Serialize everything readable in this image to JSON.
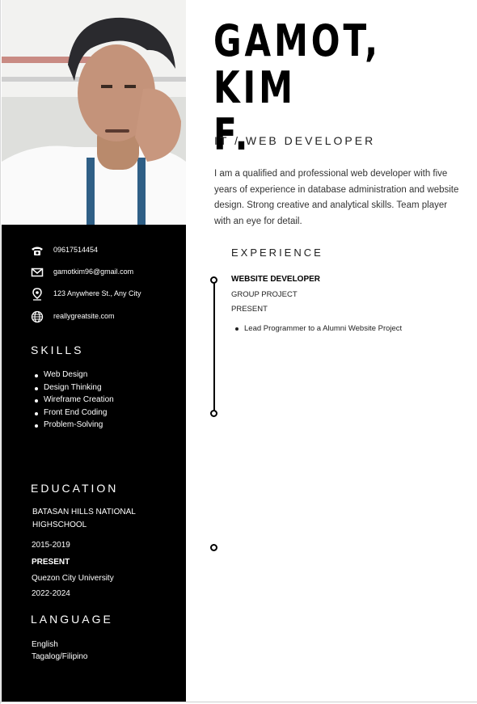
{
  "photo": {
    "description_icon": "profile-photo"
  },
  "contact": {
    "phone": "09617514454",
    "email": "gamotkim96@gmail.com",
    "address": "123 Anywhere St., Any City",
    "website": "reallygreatsite.com"
  },
  "skills": {
    "title": "SKILLS",
    "items": [
      "Web Design",
      "Design Thinking",
      "Wireframe Creation",
      "Front End Coding",
      "Problem-Solving"
    ]
  },
  "education": {
    "title": "EDUCATION",
    "school1_line1": "BATASAN HILLS NATIONAL",
    "school1_line2": "HIGHSCHOOL",
    "school1_years": "2015-2019",
    "present_label": "PRESENT",
    "school2": "Quezon City University",
    "school2_years": "2022-2024"
  },
  "language": {
    "title": "LANGUAGE",
    "items": [
      "English",
      "Tagalog/Filipino"
    ]
  },
  "header": {
    "name_line1": "GAMOT, KIM",
    "name_line2": "F.",
    "role": "IT / WEB DEVELOPER"
  },
  "summary": "I am a qualified and professional web developer with five years of experience in database administration and website design. Strong creative and analytical skills. Team player with an eye for detail.",
  "experience": {
    "title": "EXPERIENCE",
    "job_title": "WEBSITE DEVELOPER",
    "company": "GROUP PROJECT",
    "period": "PRESENT",
    "bullets": [
      "Lead Programmer to a Alumni Website Project"
    ]
  }
}
